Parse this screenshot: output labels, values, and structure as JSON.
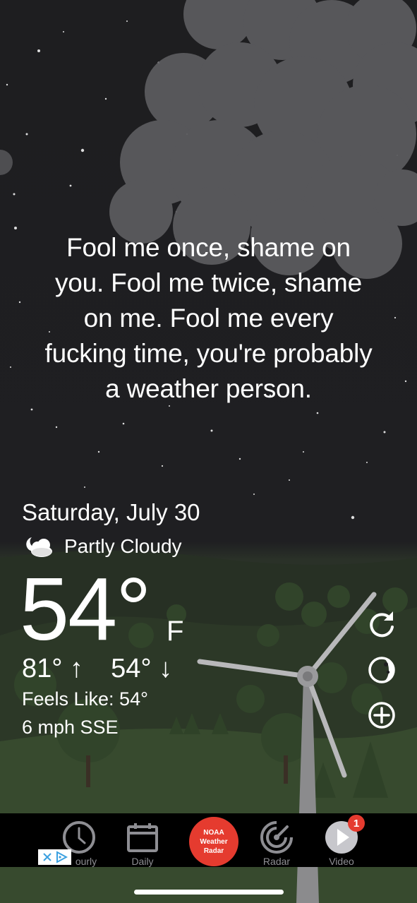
{
  "quote": {
    "lines": [
      "Fool me once, shame on",
      "you. Fool me twice, shame",
      "on me. Fool me every",
      "fucking time, you're probably",
      "a weather person."
    ]
  },
  "weather": {
    "date": "Saturday, July 30",
    "condition": "Partly Cloudy",
    "condition_icon": "partly-cloudy-night-icon",
    "temperature": "54°",
    "unit": "F",
    "high": "81°",
    "high_arrow": "↑",
    "low": "54°",
    "low_arrow": "↓",
    "feels_like": "Feels Like: 54°",
    "wind": "6 mph SSE"
  },
  "side_actions": [
    {
      "icon": "refresh-icon"
    },
    {
      "icon": "moon-phase-icon"
    },
    {
      "icon": "add-circle-icon"
    }
  ],
  "tabbar": {
    "items": [
      {
        "label": "ourly",
        "icon": "clock-icon"
      },
      {
        "label": "Daily",
        "icon": "calendar-icon"
      },
      {
        "label": "Radar",
        "icon": "radar-icon"
      },
      {
        "label": "Video",
        "icon": "play-icon"
      }
    ],
    "noaa_lines": [
      "NOAA",
      "Weather",
      "Radar"
    ],
    "video_badge": "1"
  },
  "colors": {
    "accent_red": "#e53b2f",
    "tab_label": "#8e8e93",
    "background": "#1e1e20"
  }
}
